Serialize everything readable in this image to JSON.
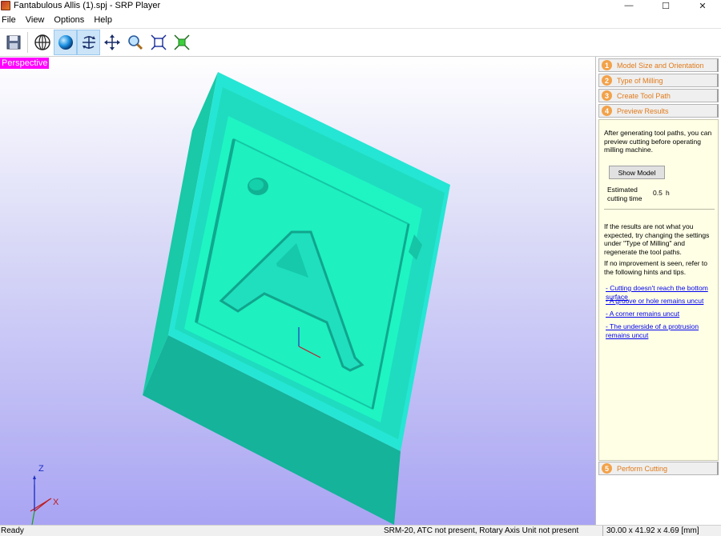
{
  "window": {
    "title": "Fantabulous Allis (1).spj - SRP Player",
    "minimize_glyph": "—",
    "maximize_glyph": "☐",
    "close_glyph": "✕"
  },
  "menu": [
    "File",
    "View",
    "Options",
    "Help"
  ],
  "toolbar": [
    {
      "icon": "save-icon",
      "active": false
    },
    {
      "icon": "wireframe-globe-icon",
      "active": false
    },
    {
      "icon": "shaded-sphere-icon",
      "active": true
    },
    {
      "icon": "rotate-axes-icon",
      "active": true
    },
    {
      "icon": "pan-move-icon",
      "active": false
    },
    {
      "icon": "zoom-magnifier-icon",
      "active": false
    },
    {
      "icon": "fit-to-window-icon",
      "active": false
    },
    {
      "icon": "fit-all-green-icon",
      "active": false
    }
  ],
  "viewport": {
    "label": "Perspective",
    "axis_labels": {
      "z": "Z",
      "x": "X"
    },
    "colors": {
      "model_top": "#1ef5c3",
      "model_side": "#13b59b",
      "model_edge": "#27e8d9"
    }
  },
  "panel": {
    "steps": [
      {
        "num": "1",
        "label": "Model Size and Orientation"
      },
      {
        "num": "2",
        "label": "Type of Milling"
      },
      {
        "num": "3",
        "label": "Create Tool Path"
      },
      {
        "num": "4",
        "label": "Preview Results"
      }
    ],
    "intro": "After generating tool paths, you can preview cutting before operating milling machine.",
    "show_model_button": "Show Model",
    "estimate_label": "Estimated cutting time",
    "estimate_value": "0.5",
    "estimate_unit": "h",
    "hint_para1": "If the results are not what you expected, try changing the settings under \"Type of Milling\" and regenerate the tool paths.",
    "hint_para2": "If no improvement is seen, refer to the following hints and tips.",
    "links": [
      "- Cutting doesn't reach the bottom surface",
      "- A groove or hole remains uncut",
      "- A corner remains uncut",
      "- The underside of a protrusion remains uncut"
    ],
    "final_step": {
      "num": "5",
      "label": "Perform Cutting"
    },
    "accent_color": "#f2a24a"
  },
  "status": {
    "ready": "Ready",
    "machine": "SRM-20, ATC not present, Rotary Axis Unit not present",
    "size": "30.00 x  41.92 x   4.69 [mm]"
  }
}
